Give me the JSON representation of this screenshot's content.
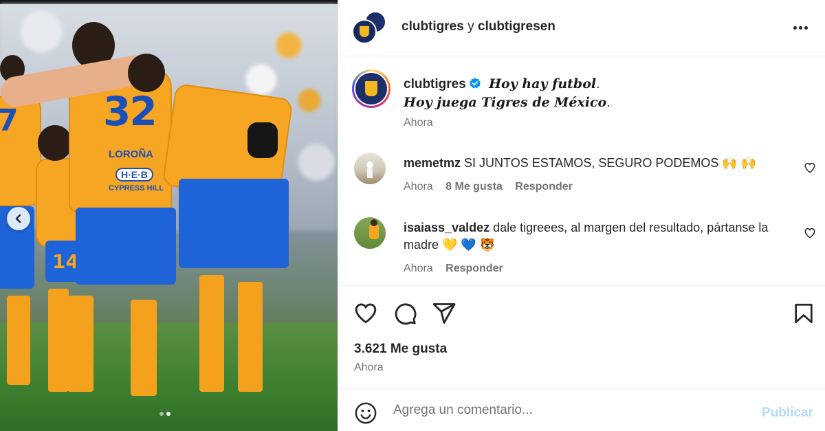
{
  "header": {
    "account_primary": "clubtigres",
    "conjunction": " y ",
    "account_secondary": "clubtigresen"
  },
  "caption": {
    "username": "clubtigres",
    "line1": "Hoy hay futbol",
    "line1_end": ".",
    "line2": "Hoy juega Tigres de México",
    "line2_end": ".",
    "time": "Ahora"
  },
  "comments": [
    {
      "username": "memetmz",
      "text": "SI JUNTOS ESTAMOS, SEGURO PODEMOS 🙌 🙌",
      "time": "Ahora",
      "likes": "8 Me gusta",
      "reply": "Responder"
    },
    {
      "username": "isaiass_valdez",
      "text": "dale tigreees, al margen del resultado, pártanse la madre 💛 💙 🐯",
      "time": "Ahora",
      "reply": "Responder"
    }
  ],
  "photo": {
    "jersey_number_1": "32",
    "jersey_name_1": "LOROÑA",
    "sponsor_1": "H·E·B",
    "sponsor_2": "CYPRESS HILL",
    "jersey_number_2": "14",
    "jersey_number_3": "7",
    "active_slide": 2,
    "total_slides": 2
  },
  "post": {
    "likes_count": "3.621 Me gusta",
    "time": "Ahora"
  },
  "add_comment": {
    "placeholder": "Agrega un comentario...",
    "publish_label": "Publicar"
  },
  "colors": {
    "tigres_gold": "#f6a623",
    "tigres_blue": "#1f63d8",
    "verified_blue": "#0095f6",
    "publish_disabled": "#b3dbff"
  }
}
